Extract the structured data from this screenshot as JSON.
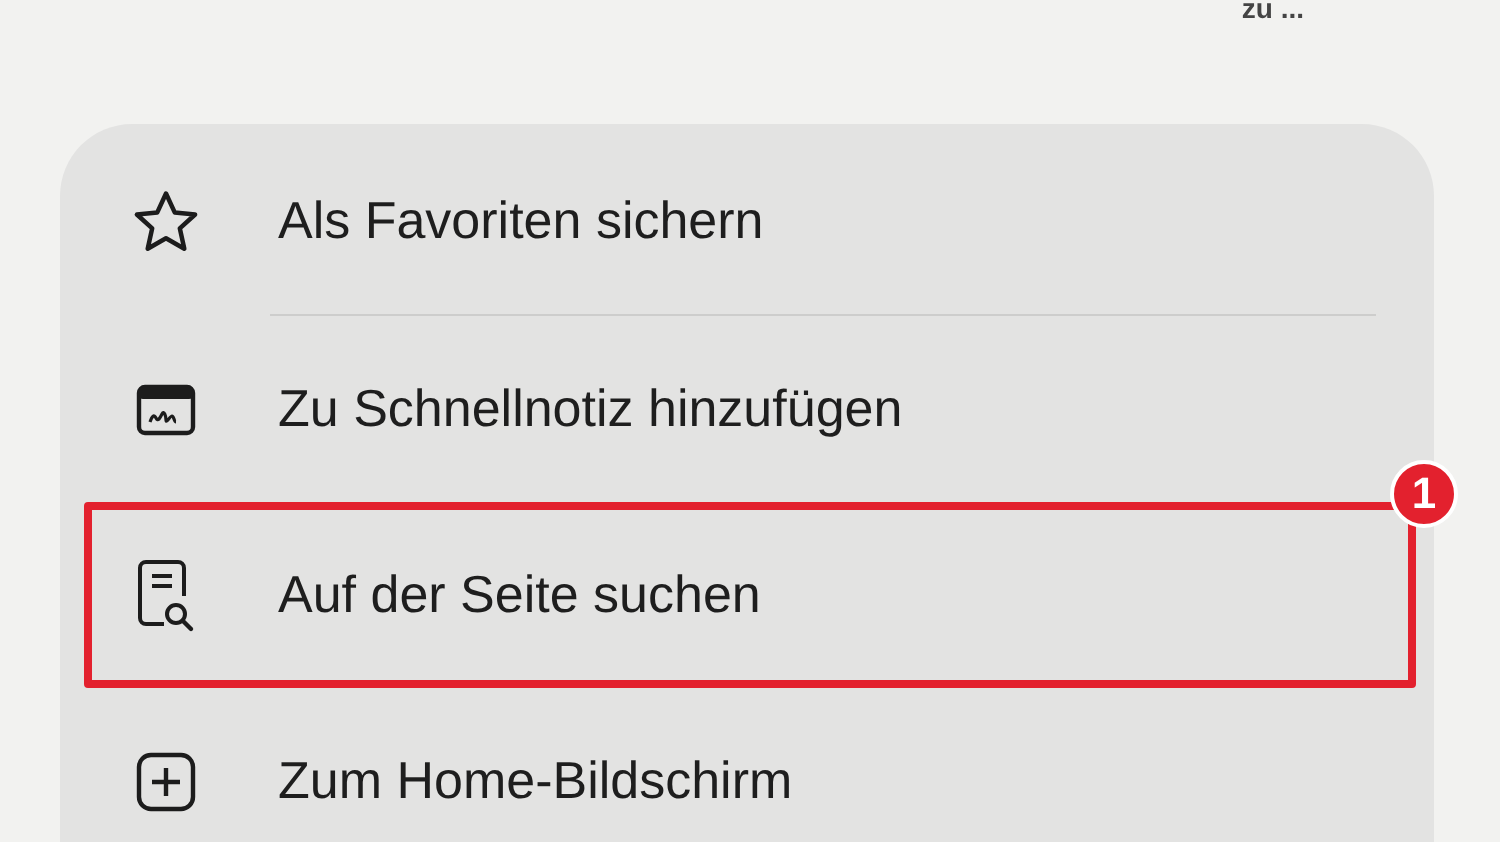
{
  "top_text": "zu ...",
  "menu": {
    "items": [
      {
        "label": "Als Favoriten sichern",
        "kind": "star",
        "separator": true,
        "highlighted": false
      },
      {
        "label": "Zu Schnellnotiz hinzufügen",
        "kind": "note",
        "separator": false,
        "highlighted": false
      },
      {
        "label": "Auf der Seite suchen",
        "kind": "find",
        "separator": false,
        "highlighted": true,
        "badge": "1"
      },
      {
        "label": "Zum Home-Bildschirm",
        "kind": "plus",
        "separator": false,
        "highlighted": false
      }
    ]
  }
}
